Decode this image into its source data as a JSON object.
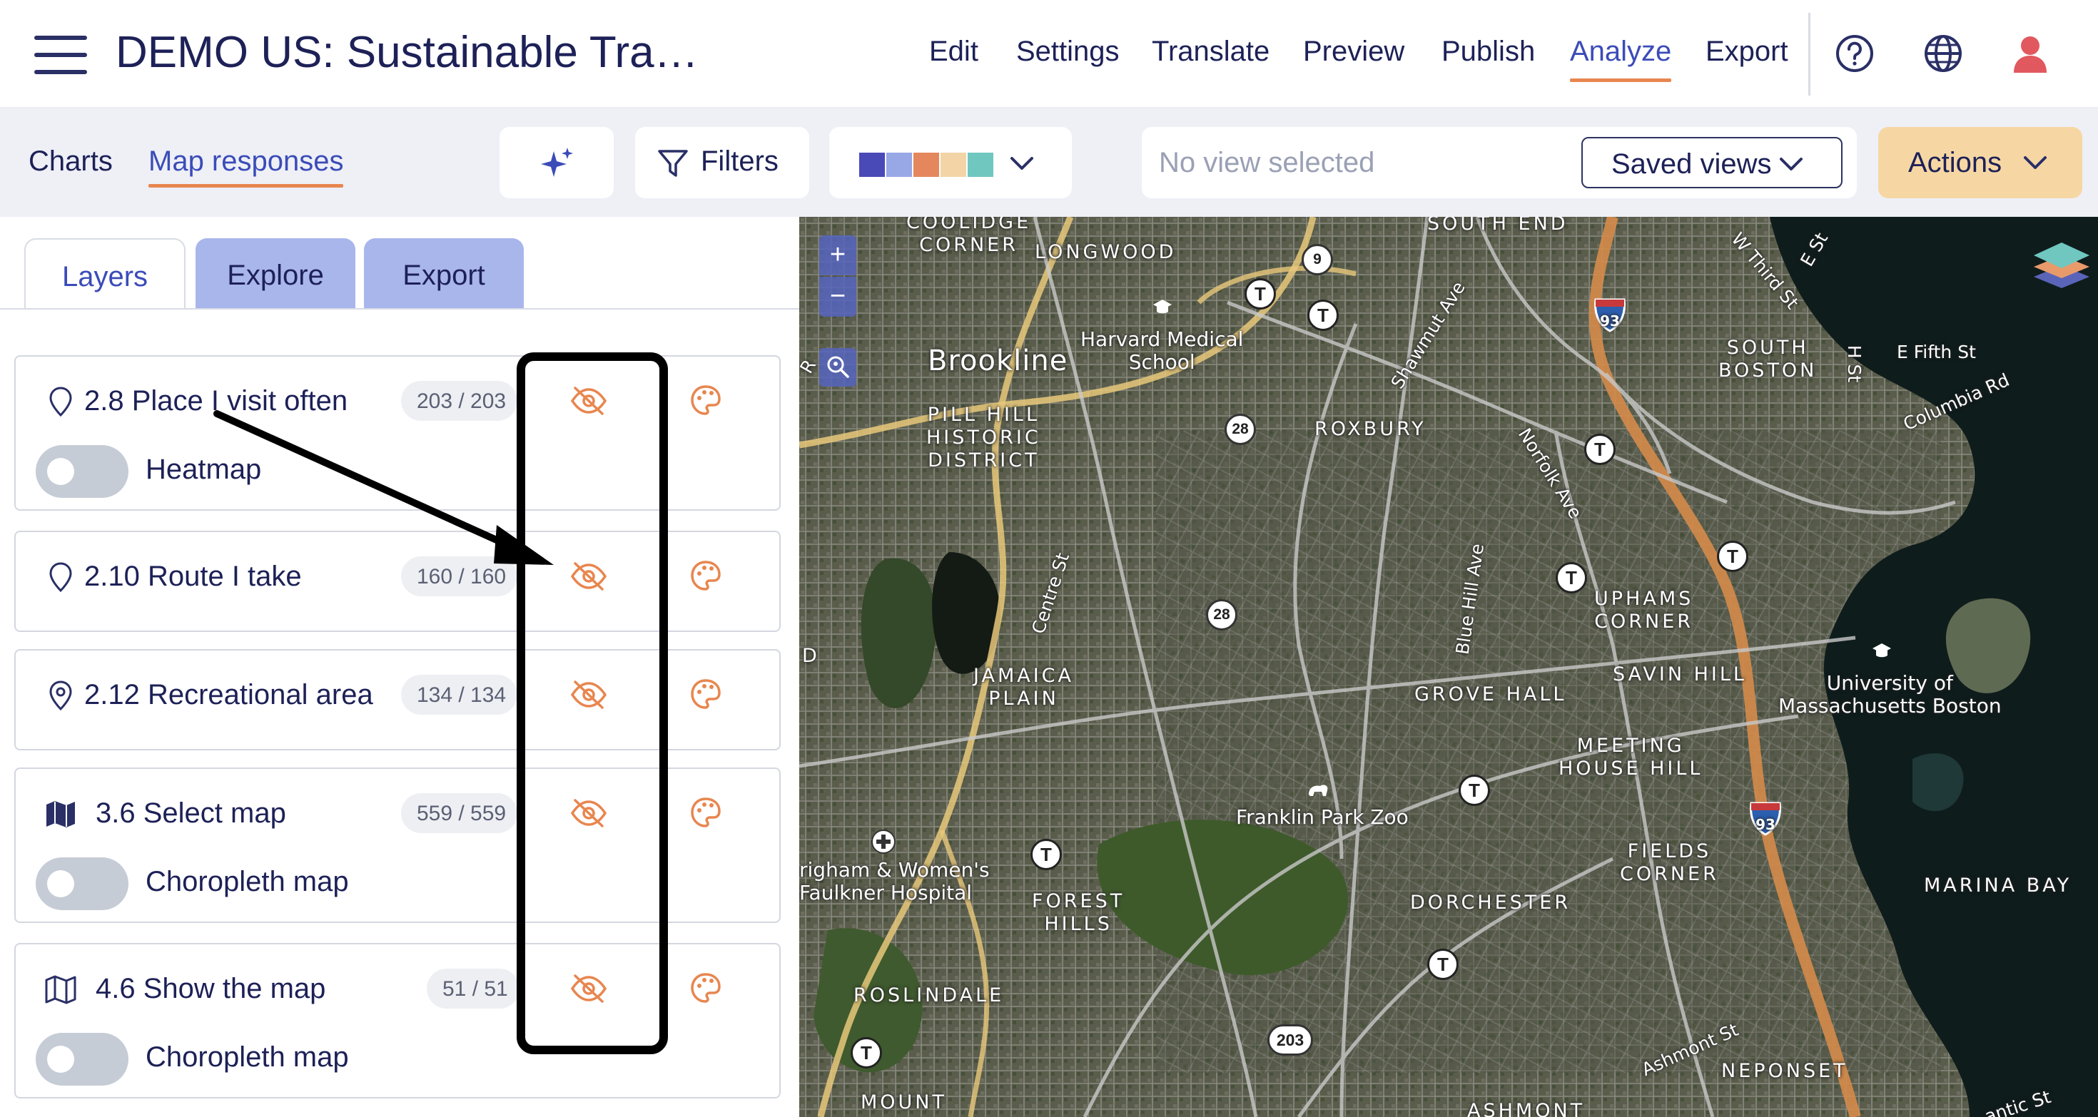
{
  "header": {
    "app_title": "DEMO US: Sustainable Tra…",
    "nav": [
      "Edit",
      "Settings",
      "Translate",
      "Preview",
      "Publish",
      "Analyze",
      "Export"
    ],
    "active_nav": "Analyze",
    "icons": [
      "hamburger-menu-icon",
      "help-icon",
      "globe-icon",
      "user-icon"
    ]
  },
  "subbar": {
    "tabs": [
      "Charts",
      "Map responses"
    ],
    "active_tab": "Map responses",
    "filters_label": "Filters",
    "palette_colors": [
      "#4a49b8",
      "#98a8e6",
      "#e5875c",
      "#f2d4a6",
      "#6fc7c0"
    ],
    "view_placeholder": "No view selected",
    "saved_views_label": "Saved views",
    "actions_label": "Actions"
  },
  "panel": {
    "tabs": [
      "Layers",
      "Explore",
      "Export"
    ],
    "active_tab": "Layers",
    "layers": [
      {
        "title": "2.8 Place I visit often",
        "count": "203 / 203",
        "icon": "map-pin-icon",
        "toggle_label": "Heatmap"
      },
      {
        "title": "2.10 Route I take",
        "count": "160 / 160",
        "icon": "map-pin-icon",
        "toggle_label": ""
      },
      {
        "title": "2.12 Recreational area",
        "count": "134 / 134",
        "icon": "map-pin-icon",
        "toggle_label": ""
      },
      {
        "title": "3.6 Select map",
        "count": "559 / 559",
        "icon": "map-filled-icon",
        "toggle_label": "Choropleth map"
      },
      {
        "title": "4.6 Show the map",
        "count": "51 / 51",
        "icon": "map-outline-icon",
        "toggle_label": "Choropleth map"
      }
    ],
    "accent_color": "#e8864f"
  },
  "map": {
    "zoom_in": "+",
    "zoom_out": "−",
    "labels": {
      "coolidge_corner": "COOLIDGE\nCORNER",
      "longwood": "LONGWOOD",
      "south_end": "SOUTH END",
      "brookline": "Brookline",
      "harvard": "Harvard Medical\nSchool",
      "pill_hill": "PILL HILL\nHISTORIC\nDISTRICT",
      "roxbury": "ROXBURY",
      "south_boston": "SOUTH\nBOSTON",
      "e_fifth": "E Fifth St",
      "columbia": "Columbia Rd",
      "w_third": "W Third St",
      "e_st": "E St",
      "h_st": "H St",
      "shawmut": "Shawmut Ave",
      "norfolk": "Norfolk Ave",
      "centre": "Centre St",
      "blue_hill": "Blue Hill Ave",
      "jamaica_plain": "JAMAICA\nPLAIN",
      "grove_hall": "GROVE HALL",
      "uphams": "UPHAMS\nCORNER",
      "savin_hill": "SAVIN HILL",
      "umass": "University of\nMassachusetts Boston",
      "meeting_house": "MEETING\nHOUSE HILL",
      "franklin_park": "Franklin Park Zoo",
      "brigham": "righam & Women's\nFaulkner Hospital",
      "forest_hills": "FOREST\nHILLS",
      "dorchester": "DORCHESTER",
      "fields_corner": "FIELDS\nCORNER",
      "marina_bay": "MARINA BAY",
      "roslindale": "ROSLINDALE",
      "ashmont_st": "Ashmont St",
      "neponset": "NEPONSET",
      "mount": "MOUNT",
      "ashmont": "ASHMONT",
      "antic": "antic St",
      "edge_d": "D",
      "edge_r": "R",
      "shield_9": "9",
      "shield_28": "28",
      "shield_93": "93",
      "shield_203": "203",
      "t_stop": "T"
    }
  }
}
